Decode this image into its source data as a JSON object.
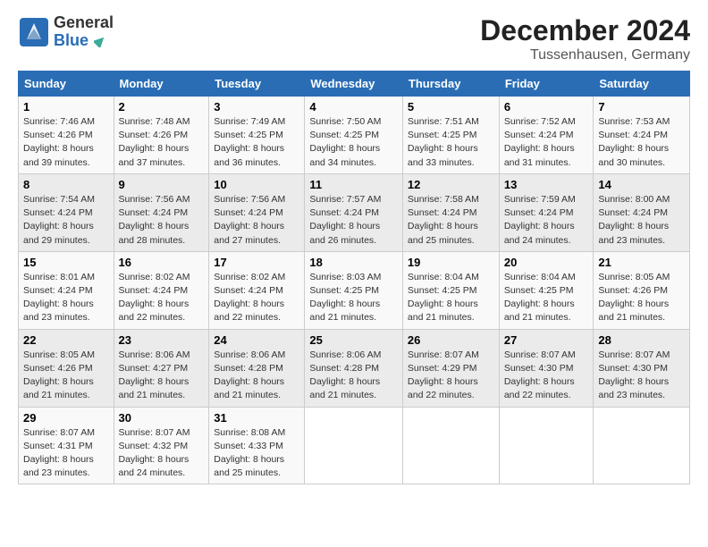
{
  "header": {
    "logo_general": "General",
    "logo_blue": "Blue",
    "main_title": "December 2024",
    "sub_title": "Tussenhausen, Germany"
  },
  "days_of_week": [
    "Sunday",
    "Monday",
    "Tuesday",
    "Wednesday",
    "Thursday",
    "Friday",
    "Saturday"
  ],
  "weeks": [
    [
      {
        "day": "1",
        "sunrise": "7:46 AM",
        "sunset": "4:26 PM",
        "daylight": "8 hours and 39 minutes."
      },
      {
        "day": "2",
        "sunrise": "7:48 AM",
        "sunset": "4:26 PM",
        "daylight": "8 hours and 37 minutes."
      },
      {
        "day": "3",
        "sunrise": "7:49 AM",
        "sunset": "4:25 PM",
        "daylight": "8 hours and 36 minutes."
      },
      {
        "day": "4",
        "sunrise": "7:50 AM",
        "sunset": "4:25 PM",
        "daylight": "8 hours and 34 minutes."
      },
      {
        "day": "5",
        "sunrise": "7:51 AM",
        "sunset": "4:25 PM",
        "daylight": "8 hours and 33 minutes."
      },
      {
        "day": "6",
        "sunrise": "7:52 AM",
        "sunset": "4:24 PM",
        "daylight": "8 hours and 31 minutes."
      },
      {
        "day": "7",
        "sunrise": "7:53 AM",
        "sunset": "4:24 PM",
        "daylight": "8 hours and 30 minutes."
      }
    ],
    [
      {
        "day": "8",
        "sunrise": "7:54 AM",
        "sunset": "4:24 PM",
        "daylight": "8 hours and 29 minutes."
      },
      {
        "day": "9",
        "sunrise": "7:56 AM",
        "sunset": "4:24 PM",
        "daylight": "8 hours and 28 minutes."
      },
      {
        "day": "10",
        "sunrise": "7:56 AM",
        "sunset": "4:24 PM",
        "daylight": "8 hours and 27 minutes."
      },
      {
        "day": "11",
        "sunrise": "7:57 AM",
        "sunset": "4:24 PM",
        "daylight": "8 hours and 26 minutes."
      },
      {
        "day": "12",
        "sunrise": "7:58 AM",
        "sunset": "4:24 PM",
        "daylight": "8 hours and 25 minutes."
      },
      {
        "day": "13",
        "sunrise": "7:59 AM",
        "sunset": "4:24 PM",
        "daylight": "8 hours and 24 minutes."
      },
      {
        "day": "14",
        "sunrise": "8:00 AM",
        "sunset": "4:24 PM",
        "daylight": "8 hours and 23 minutes."
      }
    ],
    [
      {
        "day": "15",
        "sunrise": "8:01 AM",
        "sunset": "4:24 PM",
        "daylight": "8 hours and 23 minutes."
      },
      {
        "day": "16",
        "sunrise": "8:02 AM",
        "sunset": "4:24 PM",
        "daylight": "8 hours and 22 minutes."
      },
      {
        "day": "17",
        "sunrise": "8:02 AM",
        "sunset": "4:24 PM",
        "daylight": "8 hours and 22 minutes."
      },
      {
        "day": "18",
        "sunrise": "8:03 AM",
        "sunset": "4:25 PM",
        "daylight": "8 hours and 21 minutes."
      },
      {
        "day": "19",
        "sunrise": "8:04 AM",
        "sunset": "4:25 PM",
        "daylight": "8 hours and 21 minutes."
      },
      {
        "day": "20",
        "sunrise": "8:04 AM",
        "sunset": "4:25 PM",
        "daylight": "8 hours and 21 minutes."
      },
      {
        "day": "21",
        "sunrise": "8:05 AM",
        "sunset": "4:26 PM",
        "daylight": "8 hours and 21 minutes."
      }
    ],
    [
      {
        "day": "22",
        "sunrise": "8:05 AM",
        "sunset": "4:26 PM",
        "daylight": "8 hours and 21 minutes."
      },
      {
        "day": "23",
        "sunrise": "8:06 AM",
        "sunset": "4:27 PM",
        "daylight": "8 hours and 21 minutes."
      },
      {
        "day": "24",
        "sunrise": "8:06 AM",
        "sunset": "4:28 PM",
        "daylight": "8 hours and 21 minutes."
      },
      {
        "day": "25",
        "sunrise": "8:06 AM",
        "sunset": "4:28 PM",
        "daylight": "8 hours and 21 minutes."
      },
      {
        "day": "26",
        "sunrise": "8:07 AM",
        "sunset": "4:29 PM",
        "daylight": "8 hours and 22 minutes."
      },
      {
        "day": "27",
        "sunrise": "8:07 AM",
        "sunset": "4:30 PM",
        "daylight": "8 hours and 22 minutes."
      },
      {
        "day": "28",
        "sunrise": "8:07 AM",
        "sunset": "4:30 PM",
        "daylight": "8 hours and 23 minutes."
      }
    ],
    [
      {
        "day": "29",
        "sunrise": "8:07 AM",
        "sunset": "4:31 PM",
        "daylight": "8 hours and 23 minutes."
      },
      {
        "day": "30",
        "sunrise": "8:07 AM",
        "sunset": "4:32 PM",
        "daylight": "8 hours and 24 minutes."
      },
      {
        "day": "31",
        "sunrise": "8:08 AM",
        "sunset": "4:33 PM",
        "daylight": "8 hours and 25 minutes."
      },
      null,
      null,
      null,
      null
    ]
  ]
}
